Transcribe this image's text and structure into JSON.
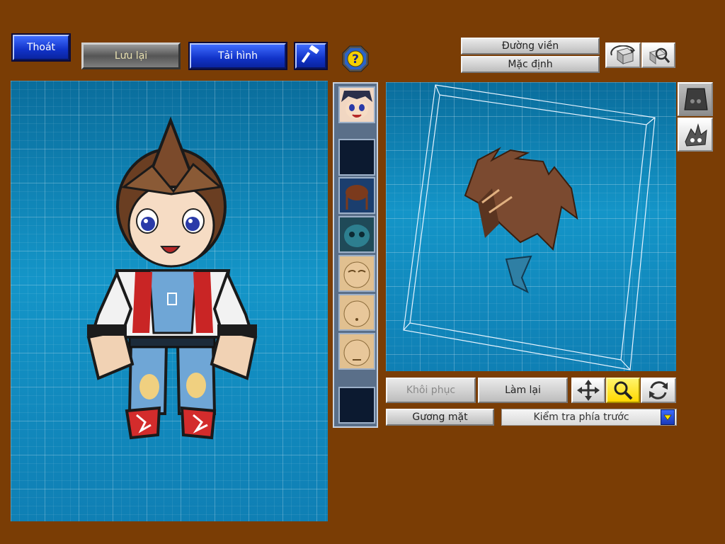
{
  "toolbar": {
    "exit_label": "Thoát",
    "save_label": "Lưu lại",
    "load_image_label": "Tải hình"
  },
  "view_options": {
    "outline_label": "Đường viền",
    "default_label": "Mặc định"
  },
  "editor_controls": {
    "restore_label": "Khôi phục",
    "redo_label": "Làm lại",
    "face_label": "Gương mặt",
    "check_select_value": "Kiểm tra phía trước"
  },
  "icons": {
    "hammer": "hammer-icon",
    "help": "help-icon",
    "rotate_3d": "rotate-3d-icon",
    "zoom_view": "zoom-view-icon",
    "move": "move-icon",
    "zoom": "zoom-icon",
    "rotate": "rotate-icon",
    "dropdown": "chevron-down-icon"
  },
  "colors": {
    "background": "#7a3d05",
    "grid": "#0e7fb0",
    "button_blue": "#1133c8",
    "zoom_active": "#ffe400"
  }
}
